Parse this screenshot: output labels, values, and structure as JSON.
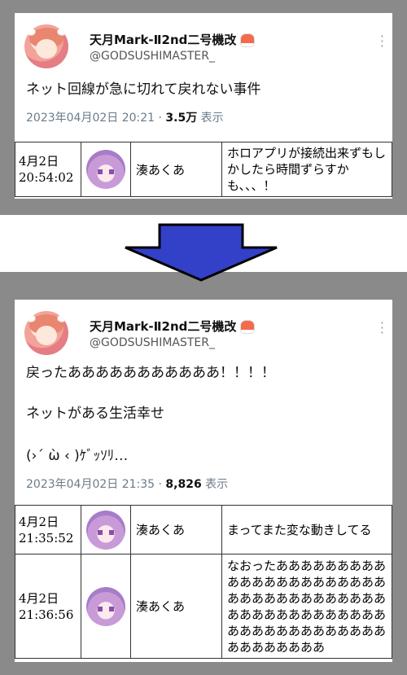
{
  "top_tweet": {
    "username": "天月Mark-Ⅱ2nd二号機改",
    "handle": "@GODSUSHIMASTER_",
    "text": "ネット回線が急に切れて戻れない事件",
    "timestamp": "2023年04月02日 20:21 · ",
    "views_count": "3.5万",
    "views_label": " 表示",
    "chat": [
      {
        "time_date": "4月2日",
        "time_clock": "20:54:02",
        "name": "湊あくあ",
        "message": "ホロアプリが接続出来ずもしかしたら時間ずらすかも、、、！"
      }
    ]
  },
  "bottom_tweet": {
    "username": "天月Mark-Ⅱ2nd二号機改",
    "handle": "@GODSUSHIMASTER_",
    "text_line1": "戻ったあああああああああああ！！！！",
    "text_line2": "ネットがある生活幸せ",
    "text_line3": "(›´ ὼ ‹ )ｹﾞｯｿﾘ…",
    "timestamp": "2023年04月02日 21:35 · ",
    "views_count": "8,826",
    "views_label": " 表示",
    "chat": [
      {
        "time_date": "4月2日",
        "time_clock": "21:35:52",
        "name": "湊あくあ",
        "message": "まってまた変な動きしてる"
      },
      {
        "time_date": "4月2日",
        "time_clock": "21:36:56",
        "name": "湊あくあ",
        "message": "なおったあああああああああああああああああああああああああああああああああああああああああああああああああああああああああああああああああああああ"
      }
    ]
  },
  "colors": {
    "arrow_fill": "#3340c8",
    "page_bg": "#8a8a8a",
    "meta_text": "#6a7b8a"
  },
  "icons": [
    "sushi-emoji-icon",
    "more-options-icon",
    "down-arrow-icon"
  ]
}
